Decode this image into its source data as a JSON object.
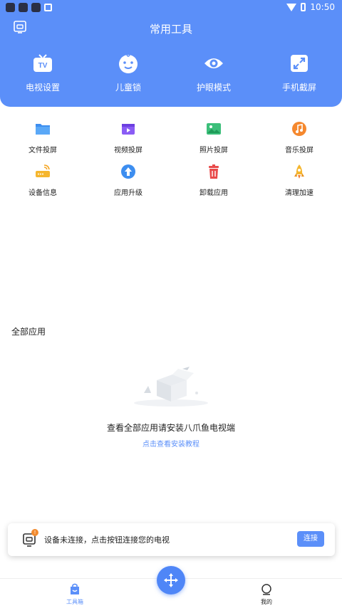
{
  "status_bar": {
    "time": "10:50"
  },
  "header": {
    "title": "常用工具",
    "tools": [
      {
        "label": "电视设置",
        "icon": "tv-icon"
      },
      {
        "label": "儿童锁",
        "icon": "baby-face-icon"
      },
      {
        "label": "护眼模式",
        "icon": "eye-icon"
      },
      {
        "label": "手机截屏",
        "icon": "screenshot-icon"
      }
    ]
  },
  "grid": [
    {
      "label": "文件投屏",
      "icon": "folder-icon"
    },
    {
      "label": "视频投屏",
      "icon": "video-icon"
    },
    {
      "label": "照片投屏",
      "icon": "photo-icon"
    },
    {
      "label": "音乐投屏",
      "icon": "music-icon"
    },
    {
      "label": "设备信息",
      "icon": "router-icon"
    },
    {
      "label": "应用升级",
      "icon": "upgrade-icon"
    },
    {
      "label": "卸载应用",
      "icon": "trash-icon"
    },
    {
      "label": "清理加速",
      "icon": "rocket-icon"
    }
  ],
  "all_apps": {
    "title": "全部应用",
    "empty_text": "查看全部应用请安装八爪鱼电视端",
    "empty_link": "点击查看安装教程"
  },
  "connect_card": {
    "badge": "!",
    "text": "设备未连接，点击按钮连接您的电视",
    "button": "连接"
  },
  "bottom_nav": {
    "left_label": "工具箱",
    "right_label": "我的"
  },
  "colors": {
    "primary": "#5b8ff9",
    "badge": "#f28b2f"
  }
}
